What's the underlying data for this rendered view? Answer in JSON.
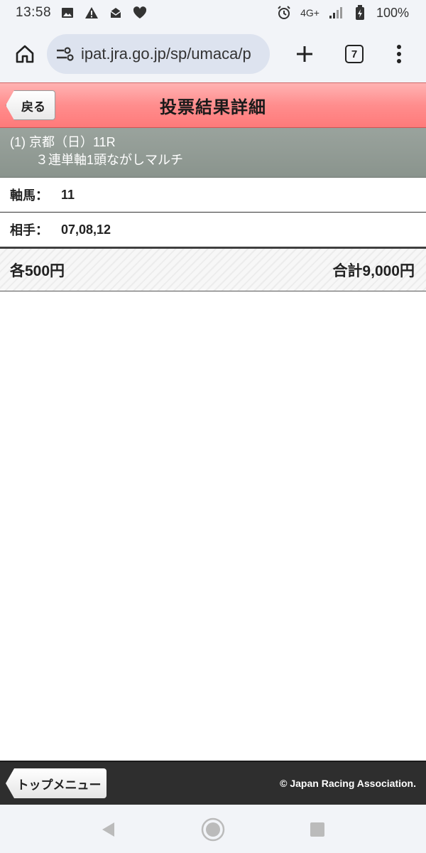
{
  "status_bar": {
    "time": "13:58",
    "network": "4G+",
    "battery": "100%"
  },
  "browser": {
    "url": "ipat.jra.go.jp/sp/umaca/p",
    "tab_count": "7"
  },
  "header": {
    "back_label": "戻る",
    "title": "投票結果詳細"
  },
  "race": {
    "line1": "(1) 京都（日）11R",
    "line2": "３連単軸1頭ながしマルチ"
  },
  "details": {
    "axis_label": "軸馬：",
    "axis_value": "11",
    "partner_label": "相手：",
    "partner_value": "07,08,12"
  },
  "totals": {
    "each": "各500円",
    "total": "合計9,000円"
  },
  "footer": {
    "top_menu_label": "トップメニュー",
    "copyright": "© Japan Racing Association."
  },
  "icons": {
    "accent": "#ff8d8d"
  }
}
